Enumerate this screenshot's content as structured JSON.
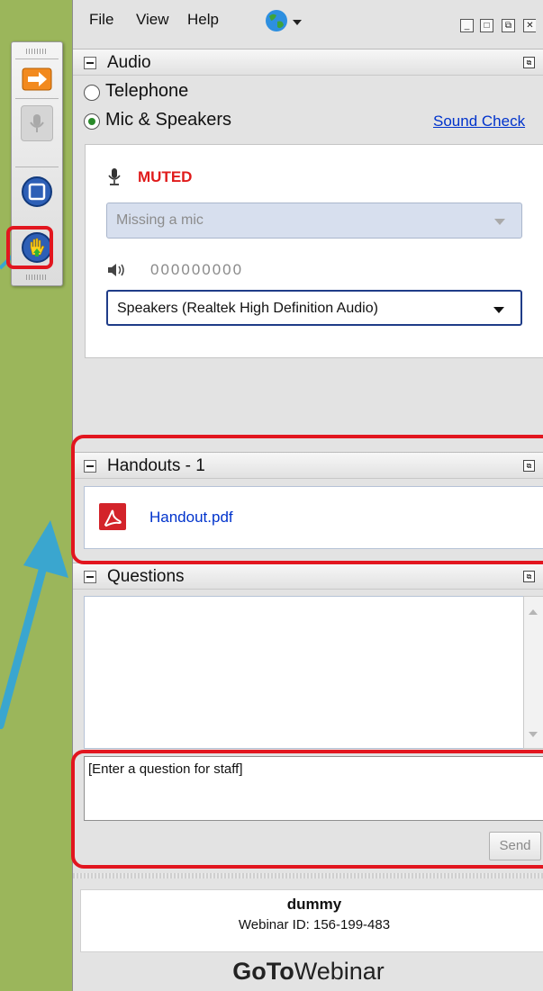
{
  "menu": {
    "file": "File",
    "view": "View",
    "help": "Help"
  },
  "audio": {
    "title": "Audio",
    "telephone_label": "Telephone",
    "mic_speakers_label": "Mic & Speakers",
    "sound_check_link": "Sound Check",
    "mic_status": "MUTED",
    "mic_dropdown_value": "Missing a mic",
    "speaker_level": "000000000",
    "speaker_dropdown_value": "Speakers (Realtek High Definition Audio)"
  },
  "handouts": {
    "title": "Handouts - 1",
    "files": [
      {
        "name": "Handout.pdf"
      }
    ]
  },
  "questions": {
    "title": "Questions",
    "input_value": "[Enter a question for staff]",
    "send_label": "Send"
  },
  "footer": {
    "organizer_name": "dummy",
    "webinar_id": "Webinar ID: 156-199-483",
    "brand_bold": "GoTo",
    "brand_light": "Webinar"
  },
  "colors": {
    "background": "#9bb65b",
    "highlight_red": "#e2161f",
    "arrow_cyan": "#3aa6cf",
    "muted_red": "#e01b1b",
    "link_blue": "#0033cc"
  },
  "icons": [
    "earth-globe-icon",
    "orange-arrow-icon",
    "microphone-icon",
    "screen-share-icon",
    "raise-hand-icon",
    "speaker-icon",
    "pdf-icon"
  ]
}
